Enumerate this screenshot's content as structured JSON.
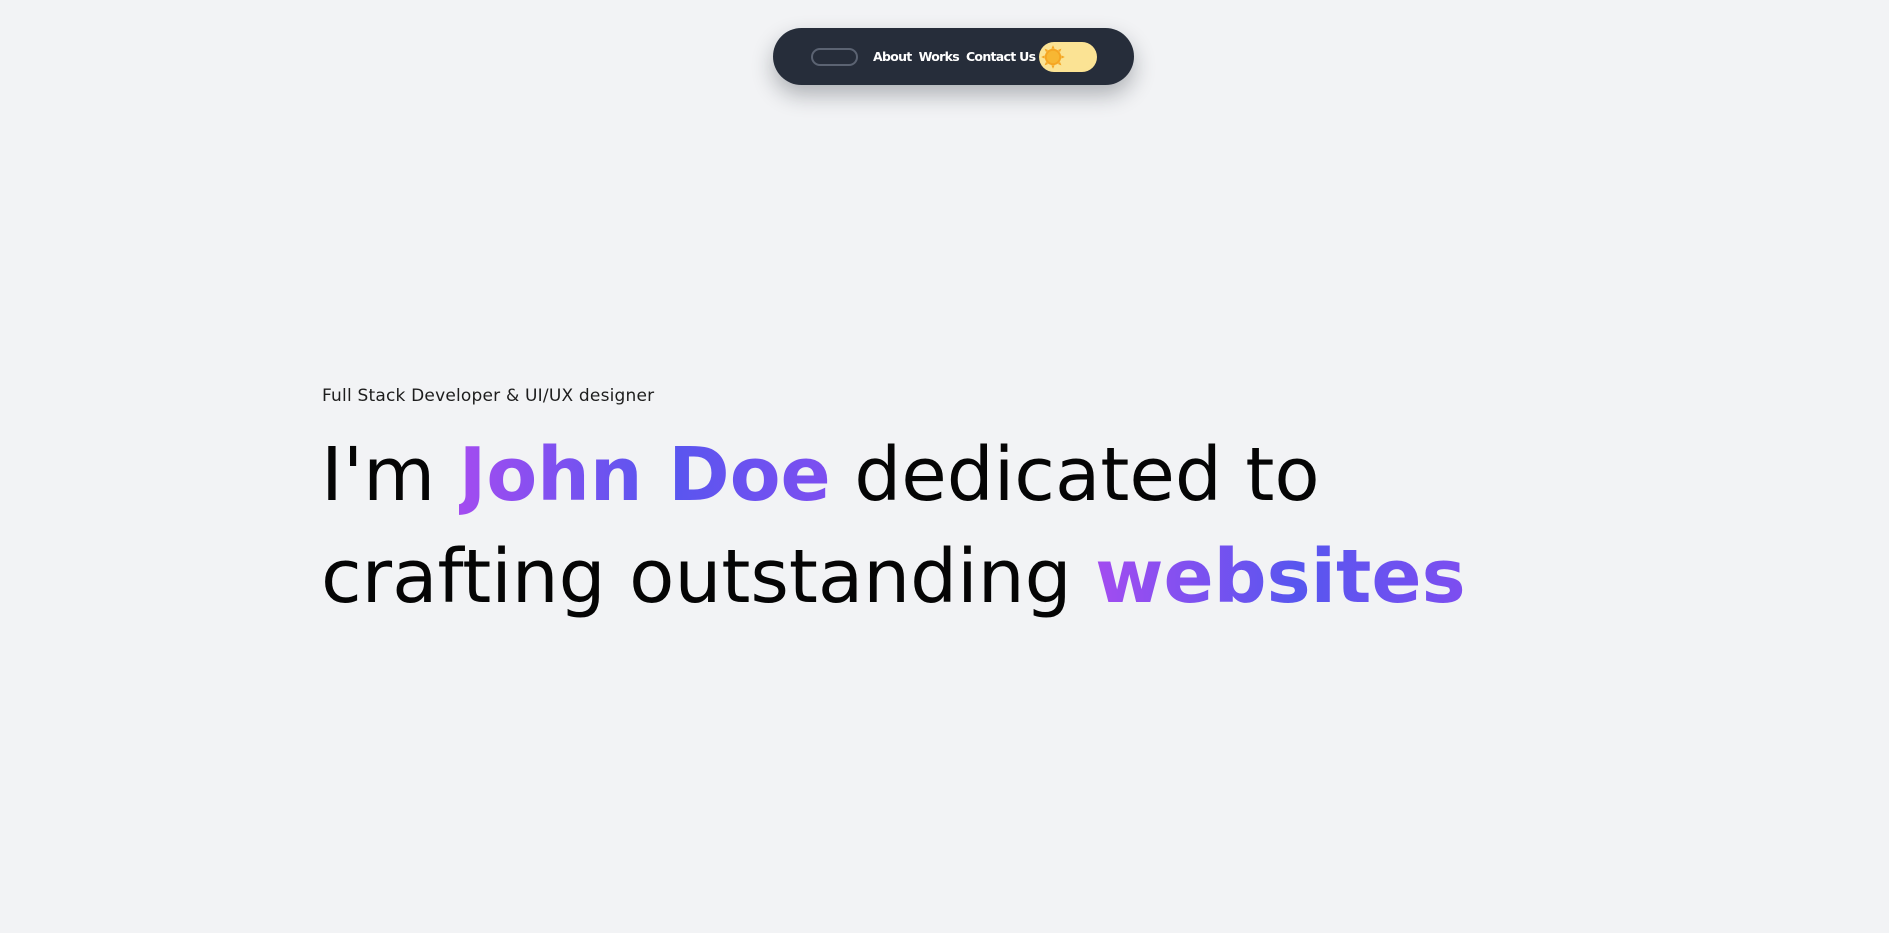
{
  "nav": {
    "links": [
      "About",
      "Works",
      "Contact Us"
    ],
    "logo_icon": "outline-pill-logo",
    "theme_toggle_icon": "sun-icon",
    "colors": {
      "bar_background": "#262d3a",
      "toggle_track": "#fbe394",
      "sun": "#f5a623"
    }
  },
  "hero": {
    "subtitle": "Full Stack Developer & UI/UX designer",
    "line1": {
      "prefix": "I'm ",
      "name": "John Doe",
      "suffix": " dedicated to"
    },
    "line2": {
      "prefix": "crafting outstanding ",
      "highlight": "websites"
    },
    "colors": {
      "page_background": "#f2f3f5",
      "text": "#050505",
      "gradient_start": "#a34cf0",
      "gradient_mid": "#5756ef",
      "gradient_end": "#7e4ef0"
    }
  }
}
